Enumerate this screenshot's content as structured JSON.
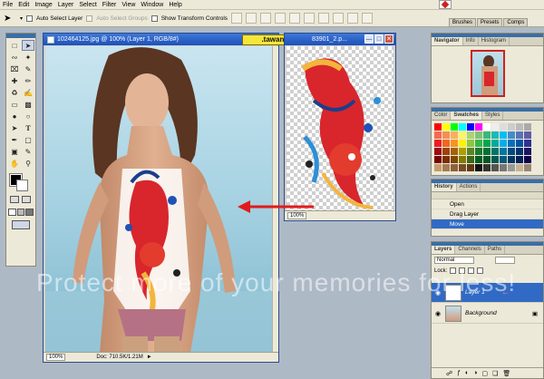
{
  "menu": [
    "File",
    "Edit",
    "Image",
    "Layer",
    "Select",
    "Filter",
    "View",
    "Window",
    "Help"
  ],
  "options": {
    "auto_select_layer": "Auto Select Layer",
    "auto_select_groups": "Auto Select Groups",
    "show_transform_controls": "Show Transform Controls"
  },
  "palette_well": [
    "Brushes",
    "Presets",
    "Comps"
  ],
  "main_window": {
    "title": "102464125.jpg @ 100% (Layer 1, RGB/8#)",
    "zoom": "100%",
    "doc_size": "Doc: 710.5K/1.21M"
  },
  "koi_window": {
    "title": "83901_2.p...",
    "zoom": "100%"
  },
  "sticker": ".tawan.",
  "watermark": "Protect more of your memories for less!",
  "navigator": {
    "tabs": [
      "Navigator",
      "Info",
      "Histogram"
    ]
  },
  "swatches": {
    "tabs": [
      "Color",
      "Swatches",
      "Styles"
    ],
    "colors": [
      "#ff0000",
      "#ffff00",
      "#00ff00",
      "#00ffff",
      "#0000ff",
      "#ff00ff",
      "#ffffff",
      "#eeeeee",
      "#dddddd",
      "#cccccc",
      "#bbbbbb",
      "#aaaaaa",
      "#f26c4f",
      "#f68e55",
      "#fbaf5c",
      "#fff467",
      "#acd372",
      "#7cc576",
      "#3bb878",
      "#1abbb4",
      "#00bff3",
      "#438ccb",
      "#5574b9",
      "#605ca8",
      "#ed1c24",
      "#f26522",
      "#f7941d",
      "#fff200",
      "#8dc63f",
      "#39b54a",
      "#00a651",
      "#00a99d",
      "#00aeef",
      "#0072bc",
      "#0054a6",
      "#2e3192",
      "#9e0b0f",
      "#a0410d",
      "#a36209",
      "#aba000",
      "#598527",
      "#1a7b30",
      "#007236",
      "#00746b",
      "#0076a3",
      "#004b80",
      "#003471",
      "#1b1464",
      "#790000",
      "#7b2e00",
      "#7d4900",
      "#827b00",
      "#406618",
      "#005e20",
      "#005826",
      "#005952",
      "#005b7f",
      "#003663",
      "#002157",
      "#0d004c",
      "#c69c6d",
      "#a67c52",
      "#8c6239",
      "#754c24",
      "#603913",
      "#111111",
      "#333333",
      "#555555",
      "#777777",
      "#999999",
      "#c7b299",
      "#998675"
    ]
  },
  "history": {
    "tabs": [
      "History",
      "Actions"
    ],
    "items": [
      "Open",
      "Drag Layer",
      "Move"
    ]
  },
  "layers": {
    "tabs": [
      "Layers",
      "Channels",
      "Paths"
    ],
    "blend_mode": "Normal",
    "lock_label": "Lock:",
    "items": [
      {
        "name": "Layer 1",
        "selected": true
      },
      {
        "name": "Background",
        "selected": false
      }
    ]
  }
}
